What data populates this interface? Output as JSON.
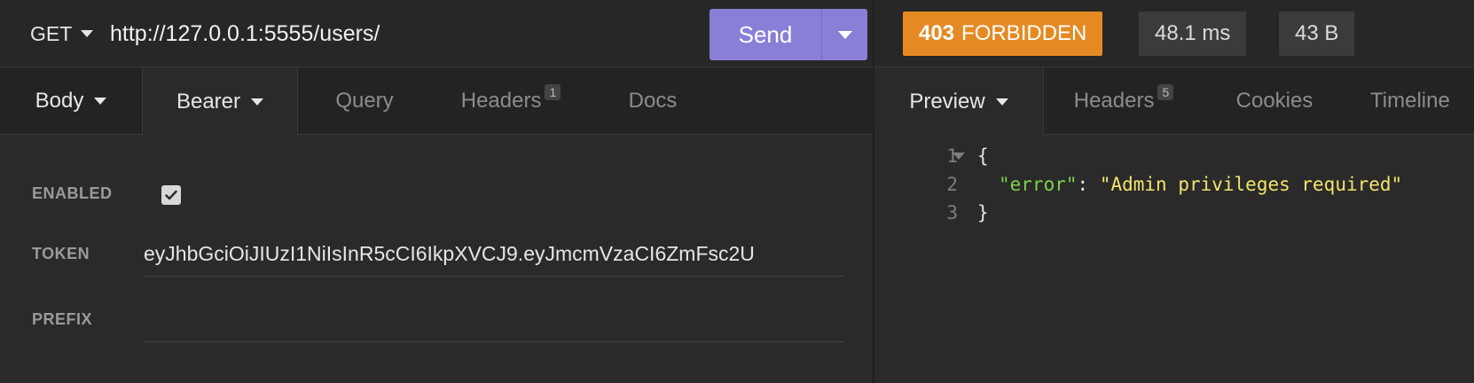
{
  "request": {
    "method": "GET",
    "url": "http://127.0.0.1:5555/users/",
    "send_label": "Send",
    "tabs": [
      {
        "label": "Body",
        "has_dropdown": true
      },
      {
        "label": "Bearer",
        "has_dropdown": true,
        "active": true
      },
      {
        "label": "Query"
      },
      {
        "label": "Headers",
        "badge": "1"
      },
      {
        "label": "Docs"
      }
    ],
    "auth": {
      "enabled_label": "ENABLED",
      "enabled": true,
      "token_label": "TOKEN",
      "token_value": "eyJhbGciOiJIUzI1NiIsInR5cCI6IkpXVCJ9.eyJmcmVzaCI6ZmFsc2U",
      "prefix_label": "PREFIX",
      "prefix_value": ""
    }
  },
  "response": {
    "status_code": "403",
    "status_text": "FORBIDDEN",
    "time": "48.1 ms",
    "size": "43 B",
    "tabs": [
      {
        "label": "Preview",
        "has_dropdown": true,
        "active": true
      },
      {
        "label": "Headers",
        "badge": "5"
      },
      {
        "label": "Cookies"
      },
      {
        "label": "Timeline"
      }
    ],
    "body_lines": [
      {
        "no": "1",
        "open": "{"
      },
      {
        "no": "2",
        "key": "\"error\"",
        "sep": ": ",
        "value": "\"Admin privileges required\""
      },
      {
        "no": "3",
        "close": "}"
      }
    ]
  },
  "colors": {
    "accent_send": "#8a7fd6",
    "status_forbidden": "#e58a23",
    "json_key": "#7fd14a",
    "json_string": "#f2e46b"
  }
}
